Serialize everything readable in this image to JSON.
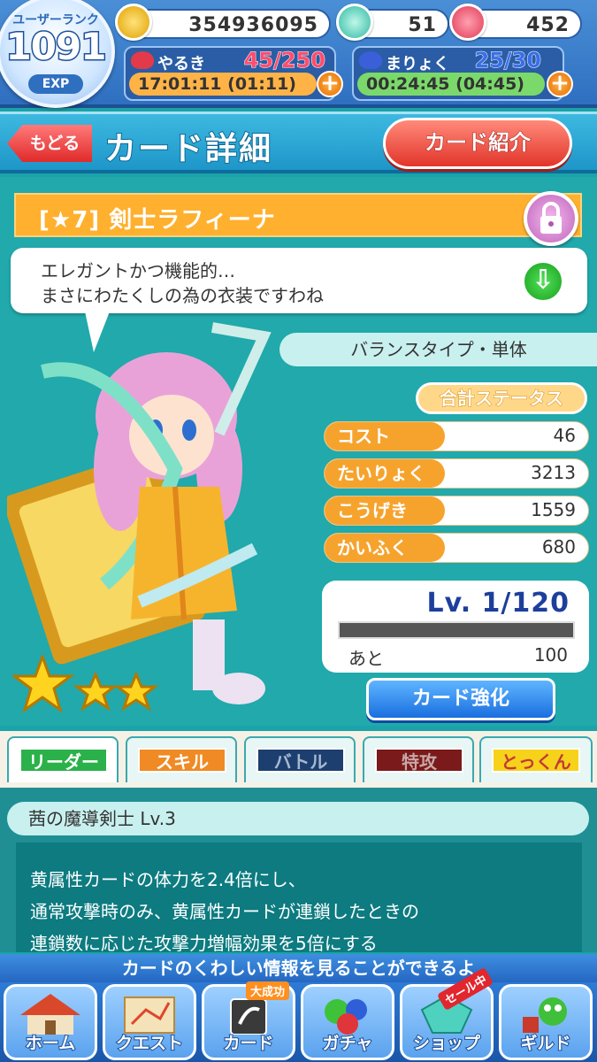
{
  "header": {
    "rank_label": "ユーザーランク",
    "rank": "1091",
    "exp_label": "EXP",
    "coins": "354936095",
    "gems": "51",
    "tickets": "452",
    "yaruki": {
      "label": "やるき",
      "value": "45/250",
      "timer": "17:01:11 (01:11)"
    },
    "maryoku": {
      "label": "まりょく",
      "value": "25/30",
      "timer": "00:24:45 (04:45)"
    },
    "plus": "+"
  },
  "titlebar": {
    "back_label": "もどる",
    "title": "カード詳細",
    "intro_label": "カード紹介"
  },
  "card": {
    "name": "[★7] 剣士ラフィーナ",
    "quote_line1": "エレガントかつ機能的…",
    "quote_line2": "まさにわたくしの為の衣装ですわね",
    "type": "バランスタイプ・単体",
    "total_status": "合計ステータス",
    "stats": [
      {
        "label": "コスト",
        "value": "46"
      },
      {
        "label": "たいりょく",
        "value": "3213"
      },
      {
        "label": "こうげき",
        "value": "1559"
      },
      {
        "label": "かいふく",
        "value": "680"
      }
    ],
    "level": "Lv. 1/120",
    "level_progress": 0.0,
    "remain_label": "あと",
    "remain_value": "100",
    "enhance_label": "カード強化",
    "stars": 3
  },
  "tabs": [
    {
      "label": "リーダー",
      "color": "#2bb14a",
      "text": "#fff"
    },
    {
      "label": "スキル",
      "color": "#f08a24",
      "text": "#fff"
    },
    {
      "label": "バトル",
      "color": "#1d3f70",
      "text": "#a8b8cf"
    },
    {
      "label": "特攻",
      "color": "#7a1a1a",
      "text": "#c9a7a7"
    },
    {
      "label": "とっくん",
      "color": "#f7d21a",
      "text": "#c23a3a"
    }
  ],
  "skill": {
    "title": "茜の魔導剣士 Lv.3",
    "line1": "黄属性カードの体力を2.4倍にし、",
    "line2": "通常攻撃時のみ、黄属性カードが連鎖したときの",
    "line3": "連鎖数に応じた攻撃力増幅効果を5倍にする"
  },
  "hint": "カードのくわしい情報を見ることができるよ",
  "nav": [
    {
      "label": "ホーム"
    },
    {
      "label": "クエスト"
    },
    {
      "label": "カード",
      "badge": "大成功"
    },
    {
      "label": "ガチャ"
    },
    {
      "label": "ショップ",
      "badge": "セール中"
    },
    {
      "label": "ギルド"
    }
  ]
}
